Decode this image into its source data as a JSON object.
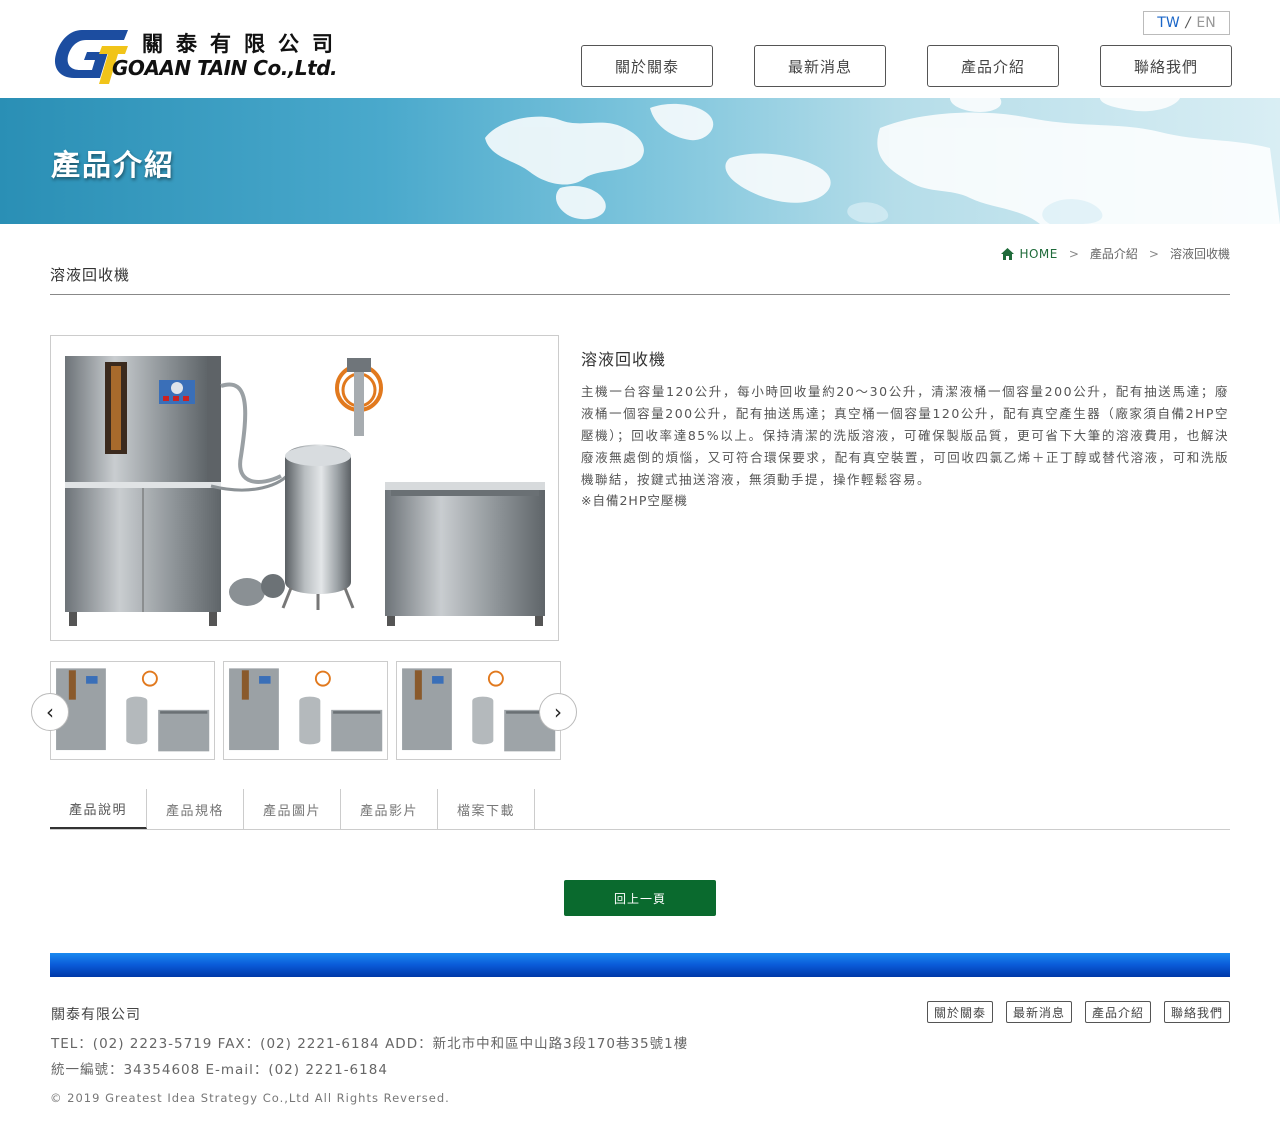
{
  "header": {
    "logo": {
      "company_cn": "關泰有限公司",
      "company_en": "GOAAN TAIN Co.,Ltd."
    },
    "lang": {
      "tw": "TW",
      "separator": "/",
      "en": "EN"
    },
    "nav": [
      {
        "label": "關於關泰"
      },
      {
        "label": "最新消息"
      },
      {
        "label": "產品介紹"
      },
      {
        "label": "聯絡我們"
      }
    ]
  },
  "banner": {
    "title": "產品介紹"
  },
  "breadcrumb": {
    "home": "HOME",
    "separator": ">",
    "category": "產品介紹",
    "current": "溶液回收機"
  },
  "page": {
    "heading": "溶液回收機"
  },
  "product": {
    "name": "溶液回收機",
    "description": "主機一台容量120公升，每小時回收量約20～30公升，清潔液桶一個容量200公升，配有抽送馬達；廢液桶一個容量200公升，配有抽送馬達；真空桶一個容量120公升，配有真空產生器（廠家須自備2HP空壓機）；回收率達85%以上。保持清潔的洗版溶液，可確保製版品質，更可省下大筆的溶液費用，也解決廢液無處倒的煩惱，又可符合環保要求，配有真空裝置，可回收四氯乙烯＋正丁醇或替代溶液，可和洗版機聯結，按鍵式抽送溶液，無須動手提，操作輕鬆容易。",
    "note": "※自備2HP空壓機"
  },
  "gallery": {
    "prev_icon": "chevron-left-icon",
    "next_icon": "chevron-right-icon",
    "prev_glyph": "‹",
    "next_glyph": "›"
  },
  "tabs": [
    {
      "label": "產品說明"
    },
    {
      "label": "產品規格"
    },
    {
      "label": "產品圖片"
    },
    {
      "label": "產品影片"
    },
    {
      "label": "檔案下載"
    }
  ],
  "back_button": "回上一頁",
  "footer": {
    "company": "關泰有限公司",
    "contact_line": "TEL：(02) 2223-5719   FAX：(02) 2221-6184   ADD：新北市中和區中山路3段170巷35號1樓",
    "contact_line2": "統一編號：34354608   E-mail：(02) 2221-6184",
    "copyright": "© 2019 Greatest Idea Strategy Co.,Ltd All Rights Reversed.",
    "nav": [
      {
        "label": "關於關泰"
      },
      {
        "label": "最新消息"
      },
      {
        "label": "產品介紹"
      },
      {
        "label": "聯絡我們"
      }
    ]
  },
  "colors": {
    "accent_green": "#0a6a2e",
    "footer_blue": "#0a5ad8",
    "lang_active": "#1a66c8"
  }
}
